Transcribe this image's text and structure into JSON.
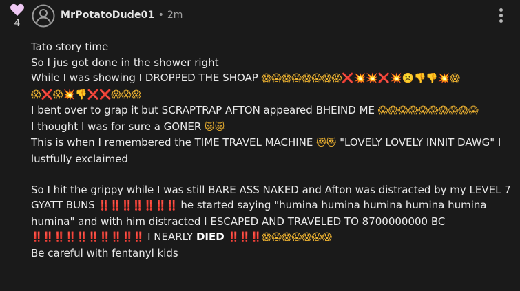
{
  "like": {
    "count": "4"
  },
  "author": {
    "name": "MrPotatoDude01",
    "separator": "•",
    "time": "2m"
  },
  "post": {
    "l1": "Tato story time",
    "l2": "So I jus got done in the shower right",
    "l3a": "While I was showing I DROPPED THE SHOAP ",
    "l3b": "😱😱😱😱😱😱😱😱",
    "l3c": "❌💥💥❌💥",
    "l3d": "☹️",
    "l3e": "👎👎",
    "l3f": "💥",
    "l3g": "😱",
    "l4a": "😱",
    "l4b": "❌",
    "l4c": "😱",
    "l4d": "💥",
    "l4e": "👎",
    "l4f": "❌❌",
    "l4g": "😱😱😱",
    "l5a": "I bent over to grap it but SCRAPTRAP AFTON appeared BHEIND ME ",
    "l5b": "😱😱😱😱😱😱😱😱😱😱",
    "l6a": "I thought I was for sure a GONER ",
    "l6b": "😿😿",
    "l7a": "This is when I remembered the TIME TRAVEL MACHINE ",
    "l7b": "😻😻",
    "l7c": " \"LOVELY LOVELY INNIT DAWG\" I lustfully exclaimed",
    "p2a": "So I hit the grippy while I was still BARE ASS NAKED and Afton was distracted by my LEVEL 7 GYATT BUNS ",
    "p2b": "‼️‼️‼️‼️‼️‼️‼️",
    "p2c": " he started saying \"humina humina humina humina humina humina\" and with him distracted I ESCAPED AND TRAVELED TO 8700000000 BC",
    "p3a": "‼️‼️‼️‼️‼️‼️‼️‼️‼️‼️",
    "p3b": " I NEARLY ",
    "p3c": "DIED",
    "p3d": " ",
    "p3e": "‼️‼️‼️",
    "p3f": "😱😱😱😱😱😱😱",
    "last": "Be careful with fentanyl kids"
  },
  "icons": {
    "like": "heart-icon",
    "avatar": "user-avatar-icon",
    "more": "more-vertical-icon"
  },
  "colors": {
    "background": "#1a1a1a",
    "text": "#e9e9e9",
    "heart": "#efc8f4",
    "danger": "#e03030"
  }
}
